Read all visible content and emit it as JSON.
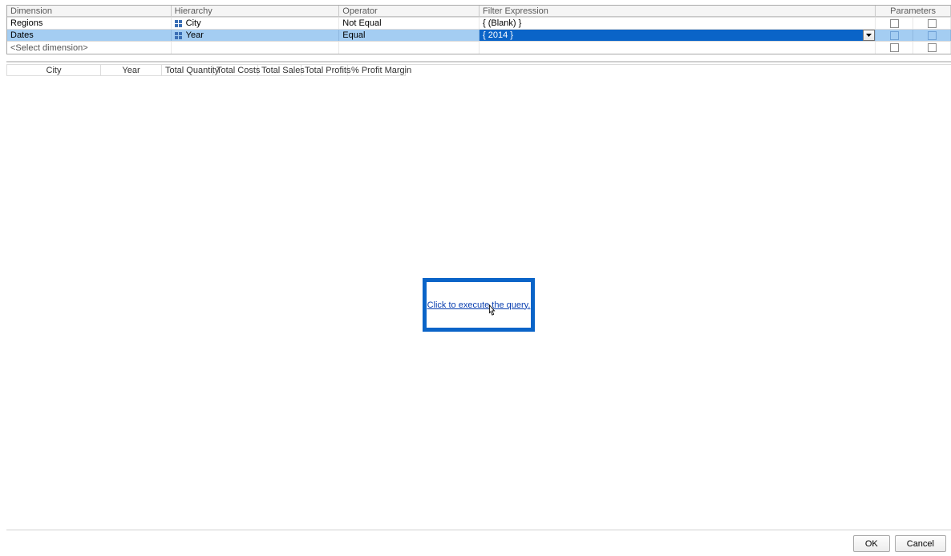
{
  "filter": {
    "headers": {
      "dimension": "Dimension",
      "hierarchy": "Hierarchy",
      "operator": "Operator",
      "expression": "Filter Expression",
      "parameters": "Parameters"
    },
    "rows": [
      {
        "dimension": "Regions",
        "hierarchy": "City",
        "operator": "Not Equal",
        "expression": "{ (Blank) }"
      },
      {
        "dimension": "Dates",
        "hierarchy": "Year",
        "operator": "Equal",
        "expression": "{ 2014 }"
      }
    ],
    "placeholder": "<Select dimension>"
  },
  "resultColumns": [
    "City",
    "Year",
    "Total Quantity",
    "Total Costs",
    "Total Sales",
    "Total Profits",
    "% Profit Margin"
  ],
  "execute": {
    "label": "Click to execute the query."
  },
  "buttons": {
    "ok": "OK",
    "cancel": "Cancel"
  }
}
